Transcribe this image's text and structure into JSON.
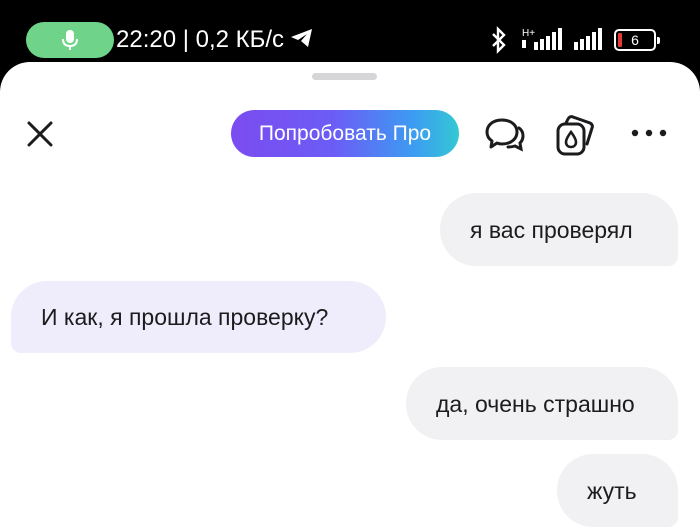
{
  "status_bar": {
    "text": "22:20 | 0,2 КБ/с",
    "network_type": "H+",
    "battery_level": "6",
    "icons": [
      "mic-icon",
      "telegram-icon",
      "bluetooth-icon",
      "signal-icon",
      "battery-icon"
    ],
    "mic_color": "#6fd48a"
  },
  "header": {
    "close_icon": "close-icon",
    "pro_button_label": "Попробовать Про",
    "chats_icon": "chat-bubbles-icon",
    "cards_icon": "cards-icon",
    "more_icon": "more-dots-icon"
  },
  "messages": [
    {
      "role": "user",
      "text": "я вас проверял"
    },
    {
      "role": "assistant",
      "text": "И как, я прошла проверку?"
    },
    {
      "role": "user",
      "text": "да, очень страшно"
    },
    {
      "role": "user",
      "text": "жуть"
    }
  ],
  "colors": {
    "user_bubble": "#f1f1f3",
    "assistant_bubble": "#efedfb",
    "pro_gradient_start": "#7b4cf0",
    "pro_gradient_end": "#33c8d3"
  }
}
